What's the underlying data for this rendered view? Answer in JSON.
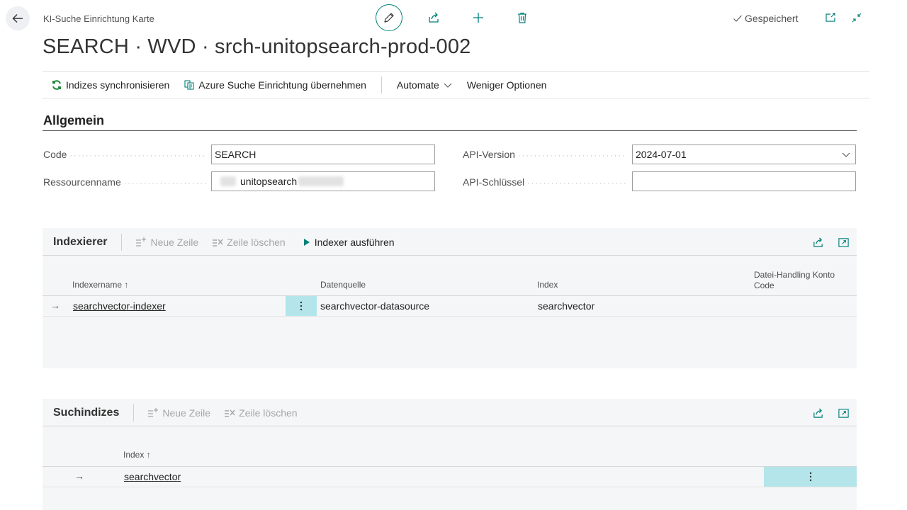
{
  "header": {
    "caption": "KI-Suche Einrichtung Karte",
    "title": "SEARCH · WVD · srch-unitopsearch-prod-002",
    "saved_label": "Gespeichert"
  },
  "actions": {
    "sync_label": "Indizes synchronisieren",
    "azure_label": "Azure Suche Einrichtung übernehmen",
    "automate_label": "Automate",
    "fewer_label": "Weniger Optionen"
  },
  "general": {
    "title": "Allgemein",
    "code_label": "Code",
    "code_value": "SEARCH",
    "resource_label": "Ressourcenname",
    "resource_value": "unitopsearch",
    "api_version_label": "API-Version",
    "api_version_value": "2024-07-01",
    "api_key_label": "API-Schlüssel",
    "api_key_value": ""
  },
  "indexer_part": {
    "title": "Indexierer",
    "new_row": "Neue Zeile",
    "delete_row": "Zeile löschen",
    "run_indexer": "Indexer ausführen",
    "columns": [
      "Indexername",
      "Datenquelle",
      "Index",
      "Datei-Handling Konto Code"
    ],
    "rows": [
      {
        "name": "searchvector-indexer",
        "datasource": "searchvector-datasource",
        "index": "searchvector",
        "code": ""
      }
    ]
  },
  "index_part": {
    "title": "Suchindizes",
    "new_row": "Neue Zeile",
    "delete_row": "Zeile löschen",
    "columns": [
      "Index"
    ],
    "rows": [
      {
        "index": "searchvector"
      }
    ]
  },
  "colors": {
    "accent": "#00817a",
    "row_selected": "#b3e5ea",
    "part_bg": "#f5f6f7",
    "sync_icon": "#1e8a3a"
  }
}
